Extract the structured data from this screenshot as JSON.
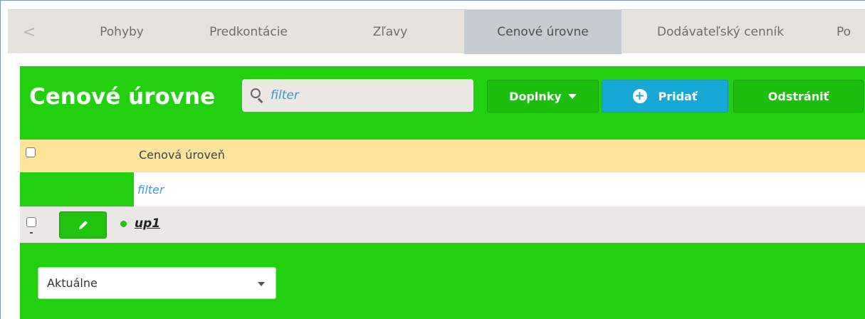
{
  "tabs": {
    "prev_arrow": "<",
    "items": [
      {
        "label": "Pohyby",
        "active": false
      },
      {
        "label": "Predkontácie",
        "active": false
      },
      {
        "label": "Zľavy",
        "active": false
      },
      {
        "label": "Cenové úrovne",
        "active": true
      },
      {
        "label": "Dodávateľský cenník",
        "active": false
      },
      {
        "label": "Po",
        "active": false
      }
    ]
  },
  "header": {
    "title": "Cenové úrovne",
    "search_placeholder": "filter",
    "doplnky_label": "Doplnky",
    "pridat_label": "Pridať",
    "odstranit_label": "Odstrániť"
  },
  "table": {
    "column_header": "Cenová úroveň",
    "filter_placeholder": "filter",
    "rows": [
      {
        "name": "up1",
        "status": "active"
      }
    ]
  },
  "view_select": {
    "value": "Aktuálne"
  },
  "colors": {
    "panel_green": "#22d010",
    "header_yellow": "#fce59a",
    "accent_blue": "#18a8d6",
    "tab_bg": "#e6e3de",
    "active_tab": "#c7cbd2"
  }
}
